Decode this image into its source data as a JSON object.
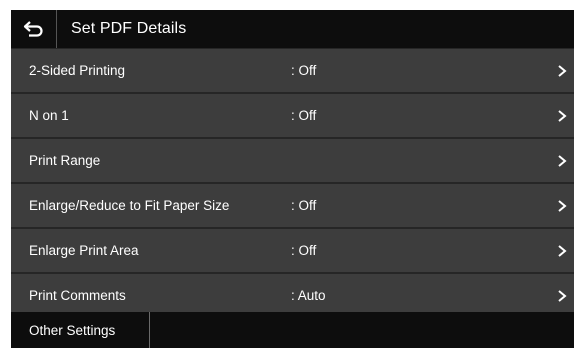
{
  "header": {
    "title": "Set PDF Details",
    "back_icon": "back-arrow-icon"
  },
  "settings": [
    {
      "label": "2-Sided Printing",
      "value": ": Off"
    },
    {
      "label": "N on 1",
      "value": ": Off"
    },
    {
      "label": "Print Range",
      "value": ""
    },
    {
      "label": "Enlarge/Reduce to Fit Paper Size",
      "value": ": Off"
    },
    {
      "label": "Enlarge Print Area",
      "value": ": Off"
    },
    {
      "label": "Print Comments",
      "value": ": Auto"
    }
  ],
  "footer": {
    "other_settings_label": "Other Settings"
  },
  "colors": {
    "background": "#262626",
    "row": "#3d3d3d",
    "header": "#0d0d0d",
    "text": "#ffffff"
  }
}
